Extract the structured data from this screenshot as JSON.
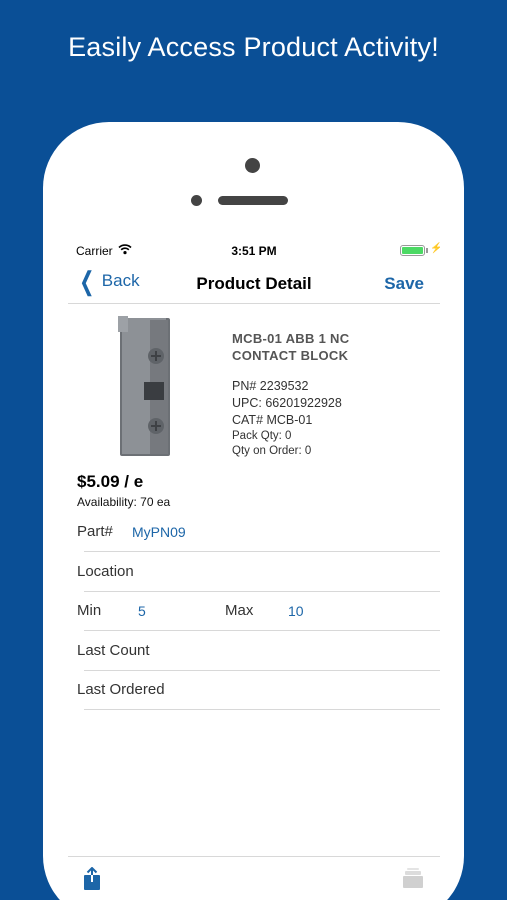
{
  "promo": {
    "headline": "Easily Access Product Activity!"
  },
  "status_bar": {
    "carrier": "Carrier",
    "time": "3:51 PM"
  },
  "navbar": {
    "back_label": "Back",
    "title": "Product Detail",
    "save_label": "Save"
  },
  "product": {
    "name_line1": "MCB-01 ABB 1 NC",
    "name_line2": "CONTACT BLOCK",
    "pn": "PN# 2239532",
    "upc": "UPC: 66201922928",
    "cat": "CAT# MCB-01",
    "pack_qty": "Pack Qty: 0",
    "qty_on_order": "Qty on Order: 0",
    "price": "$5.09 / e",
    "availability": "Availability: 70 ea"
  },
  "fields": {
    "part_label": "Part#",
    "part_value": "MyPN09",
    "location_label": "Location",
    "min_label": "Min",
    "min_value": "5",
    "max_label": "Max",
    "max_value": "10",
    "last_count_label": "Last Count",
    "last_ordered_label": "Last Ordered"
  },
  "colors": {
    "background": "#0a4f96",
    "accent": "#1d66a8",
    "battery": "#4cd964"
  },
  "icons": {
    "back": "chevron-left-icon",
    "share": "share-icon",
    "tray": "tray-icon",
    "wifi": "wifi-icon"
  }
}
